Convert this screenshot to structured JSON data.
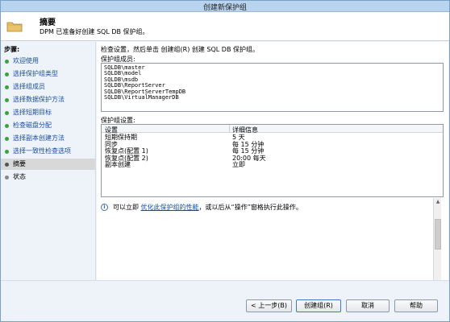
{
  "window": {
    "title": "创建新保护组"
  },
  "header": {
    "title": "摘要",
    "subtitle": "DPM 已准备好创建 SQL DB 保护组。",
    "icon": "folder-icon"
  },
  "sidebar": {
    "label": "步骤:",
    "items": [
      {
        "label": "欢迎使用",
        "state": "done"
      },
      {
        "label": "选择保护组类型",
        "state": "done"
      },
      {
        "label": "选择组成员",
        "state": "done"
      },
      {
        "label": "选择数据保护方法",
        "state": "done"
      },
      {
        "label": "选择短期目标",
        "state": "done"
      },
      {
        "label": "检查磁盘分配",
        "state": "done"
      },
      {
        "label": "选择副本创建方法",
        "state": "done"
      },
      {
        "label": "选择一致性检查选项",
        "state": "done"
      },
      {
        "label": "摘要",
        "state": "current"
      },
      {
        "label": "状态",
        "state": "pending"
      }
    ]
  },
  "main": {
    "instruction": "检查设置，然后单击 创建组(R) 创建 SQL DB 保护组。",
    "members_label": "保护组成员:",
    "members": [
      "SQLDB\\master",
      "SQLDB\\model",
      "SQLDB\\msdb",
      "SQLDB\\ReportServer",
      "SQLDB\\ReportServerTempDB",
      "SQLDB\\VirtualManagerDB"
    ],
    "settings_label": "保护组设置:",
    "settings_headers": [
      "设置",
      "详细信息"
    ],
    "settings_rows": [
      {
        "setting": "短期保持期",
        "detail": "5 天"
      },
      {
        "setting": "同步",
        "detail": "每 15 分钟"
      },
      {
        "setting": "恢复点(配置 1)",
        "detail": "每 15 分钟"
      },
      {
        "setting": "恢复点(配置 2)",
        "detail": "20:00 每天"
      },
      {
        "setting": "副本创建",
        "detail": "立即"
      }
    ],
    "info": {
      "prefix": "可以立即",
      "link": "优化此保护组的性能",
      "suffix": "，或以后从“操作”窗格执行此操作。"
    }
  },
  "footer": {
    "back": "< 上一步(B)",
    "create": "创建组(R)",
    "cancel": "取消",
    "help": "帮助"
  },
  "colors": {
    "title_bar": "#b8d4ee",
    "step_done_dot": "#3aa23a",
    "link": "#0b4fb3"
  }
}
